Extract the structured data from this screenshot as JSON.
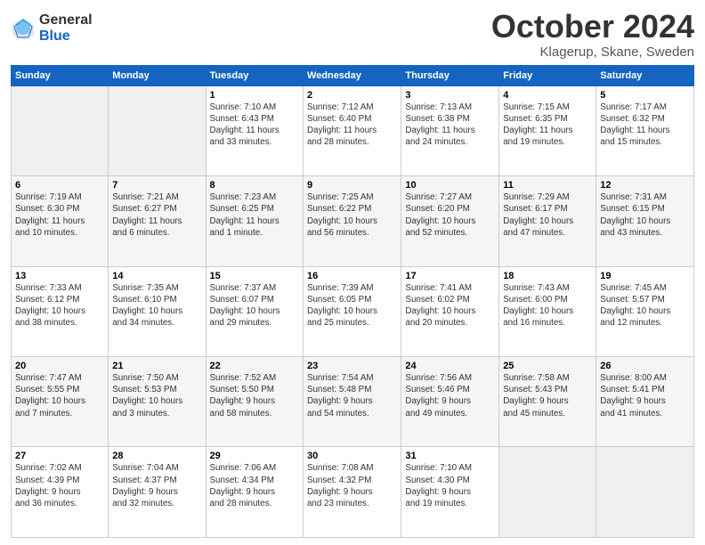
{
  "logo": {
    "general": "General",
    "blue": "Blue"
  },
  "title": "October 2024",
  "location": "Klagerup, Skane, Sweden",
  "days_header": [
    "Sunday",
    "Monday",
    "Tuesday",
    "Wednesday",
    "Thursday",
    "Friday",
    "Saturday"
  ],
  "weeks": [
    [
      {
        "num": "",
        "info": ""
      },
      {
        "num": "",
        "info": ""
      },
      {
        "num": "1",
        "info": "Sunrise: 7:10 AM\nSunset: 6:43 PM\nDaylight: 11 hours\nand 33 minutes."
      },
      {
        "num": "2",
        "info": "Sunrise: 7:12 AM\nSunset: 6:40 PM\nDaylight: 11 hours\nand 28 minutes."
      },
      {
        "num": "3",
        "info": "Sunrise: 7:13 AM\nSunset: 6:38 PM\nDaylight: 11 hours\nand 24 minutes."
      },
      {
        "num": "4",
        "info": "Sunrise: 7:15 AM\nSunset: 6:35 PM\nDaylight: 11 hours\nand 19 minutes."
      },
      {
        "num": "5",
        "info": "Sunrise: 7:17 AM\nSunset: 6:32 PM\nDaylight: 11 hours\nand 15 minutes."
      }
    ],
    [
      {
        "num": "6",
        "info": "Sunrise: 7:19 AM\nSunset: 6:30 PM\nDaylight: 11 hours\nand 10 minutes."
      },
      {
        "num": "7",
        "info": "Sunrise: 7:21 AM\nSunset: 6:27 PM\nDaylight: 11 hours\nand 6 minutes."
      },
      {
        "num": "8",
        "info": "Sunrise: 7:23 AM\nSunset: 6:25 PM\nDaylight: 11 hours\nand 1 minute."
      },
      {
        "num": "9",
        "info": "Sunrise: 7:25 AM\nSunset: 6:22 PM\nDaylight: 10 hours\nand 56 minutes."
      },
      {
        "num": "10",
        "info": "Sunrise: 7:27 AM\nSunset: 6:20 PM\nDaylight: 10 hours\nand 52 minutes."
      },
      {
        "num": "11",
        "info": "Sunrise: 7:29 AM\nSunset: 6:17 PM\nDaylight: 10 hours\nand 47 minutes."
      },
      {
        "num": "12",
        "info": "Sunrise: 7:31 AM\nSunset: 6:15 PM\nDaylight: 10 hours\nand 43 minutes."
      }
    ],
    [
      {
        "num": "13",
        "info": "Sunrise: 7:33 AM\nSunset: 6:12 PM\nDaylight: 10 hours\nand 38 minutes."
      },
      {
        "num": "14",
        "info": "Sunrise: 7:35 AM\nSunset: 6:10 PM\nDaylight: 10 hours\nand 34 minutes."
      },
      {
        "num": "15",
        "info": "Sunrise: 7:37 AM\nSunset: 6:07 PM\nDaylight: 10 hours\nand 29 minutes."
      },
      {
        "num": "16",
        "info": "Sunrise: 7:39 AM\nSunset: 6:05 PM\nDaylight: 10 hours\nand 25 minutes."
      },
      {
        "num": "17",
        "info": "Sunrise: 7:41 AM\nSunset: 6:02 PM\nDaylight: 10 hours\nand 20 minutes."
      },
      {
        "num": "18",
        "info": "Sunrise: 7:43 AM\nSunset: 6:00 PM\nDaylight: 10 hours\nand 16 minutes."
      },
      {
        "num": "19",
        "info": "Sunrise: 7:45 AM\nSunset: 5:57 PM\nDaylight: 10 hours\nand 12 minutes."
      }
    ],
    [
      {
        "num": "20",
        "info": "Sunrise: 7:47 AM\nSunset: 5:55 PM\nDaylight: 10 hours\nand 7 minutes."
      },
      {
        "num": "21",
        "info": "Sunrise: 7:50 AM\nSunset: 5:53 PM\nDaylight: 10 hours\nand 3 minutes."
      },
      {
        "num": "22",
        "info": "Sunrise: 7:52 AM\nSunset: 5:50 PM\nDaylight: 9 hours\nand 58 minutes."
      },
      {
        "num": "23",
        "info": "Sunrise: 7:54 AM\nSunset: 5:48 PM\nDaylight: 9 hours\nand 54 minutes."
      },
      {
        "num": "24",
        "info": "Sunrise: 7:56 AM\nSunset: 5:46 PM\nDaylight: 9 hours\nand 49 minutes."
      },
      {
        "num": "25",
        "info": "Sunrise: 7:58 AM\nSunset: 5:43 PM\nDaylight: 9 hours\nand 45 minutes."
      },
      {
        "num": "26",
        "info": "Sunrise: 8:00 AM\nSunset: 5:41 PM\nDaylight: 9 hours\nand 41 minutes."
      }
    ],
    [
      {
        "num": "27",
        "info": "Sunrise: 7:02 AM\nSunset: 4:39 PM\nDaylight: 9 hours\nand 36 minutes."
      },
      {
        "num": "28",
        "info": "Sunrise: 7:04 AM\nSunset: 4:37 PM\nDaylight: 9 hours\nand 32 minutes."
      },
      {
        "num": "29",
        "info": "Sunrise: 7:06 AM\nSunset: 4:34 PM\nDaylight: 9 hours\nand 28 minutes."
      },
      {
        "num": "30",
        "info": "Sunrise: 7:08 AM\nSunset: 4:32 PM\nDaylight: 9 hours\nand 23 minutes."
      },
      {
        "num": "31",
        "info": "Sunrise: 7:10 AM\nSunset: 4:30 PM\nDaylight: 9 hours\nand 19 minutes."
      },
      {
        "num": "",
        "info": ""
      },
      {
        "num": "",
        "info": ""
      }
    ]
  ]
}
